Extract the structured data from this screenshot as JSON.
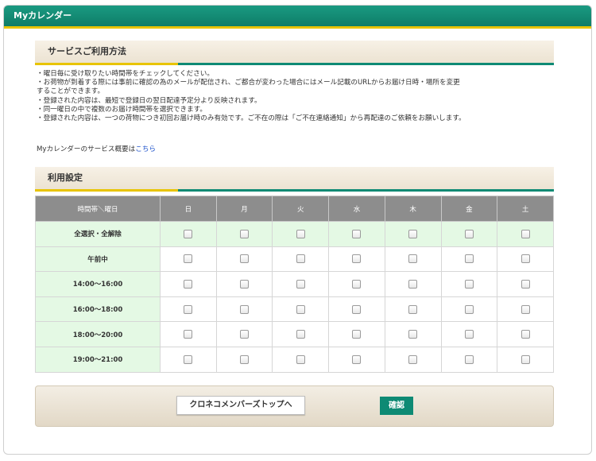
{
  "window": {
    "title": "Myカレンダー"
  },
  "section1": {
    "title": "サービスご利用方法"
  },
  "intro": [
    "・曜日毎に受け取りたい時間帯をチェックしてください。",
    "・お荷物が到着する際には事前に確認の為のメールが配信され、ご都合が変わった場合にはメール記載のURLからお届け日時・場所を変更",
    "することができます。",
    "・登録された内容は、最短で登録日の翌日配達予定分より反映されます。",
    "・同一曜日の中で複数のお届け時間帯を選択できます。",
    "・登録された内容は、一つの荷物につき初回お届け時のみ有効です。ご不在の際は「ご不在連絡通知」から再配達のご依頼をお願いします。"
  ],
  "overview": {
    "text": "Myカレンダーのサービス概要は",
    "link": "こちら"
  },
  "section2": {
    "title": "利用設定"
  },
  "table": {
    "corner": "時間帯＼曜日",
    "days": [
      "日",
      "月",
      "火",
      "水",
      "木",
      "金",
      "土"
    ],
    "rows": [
      "全選択・全解除",
      "午前中",
      "14:00〜16:00",
      "16:00〜18:00",
      "18:00〜20:00",
      "19:00〜21:00"
    ]
  },
  "footer": {
    "top_button": "クロネコメンバーズトップへ",
    "confirm_button": "確認"
  }
}
